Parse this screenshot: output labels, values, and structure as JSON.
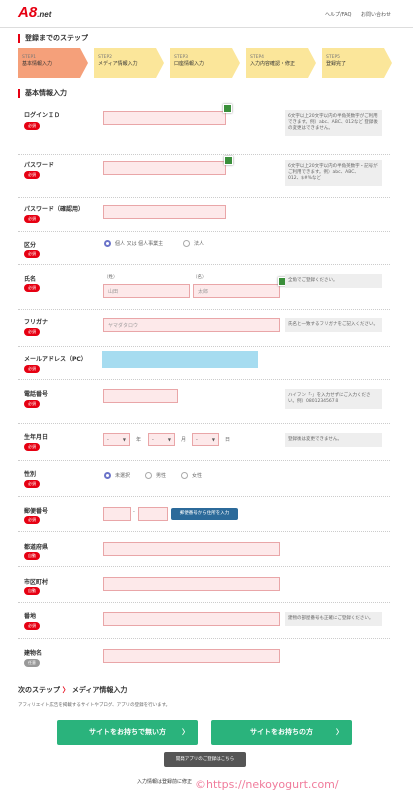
{
  "header": {
    "logo": "A8",
    "logo_sub": ".net",
    "links": [
      "ヘルプ/FAQ",
      "お問い合わせ"
    ]
  },
  "steps_title": "登録までのステップ",
  "steps": [
    {
      "num": "STEP1",
      "label": "基本情報入力"
    },
    {
      "num": "STEP2",
      "label": "メディア情報入力"
    },
    {
      "num": "STEP3",
      "label": "口座情報入力"
    },
    {
      "num": "STEP4",
      "label": "入力内容確認・修正"
    },
    {
      "num": "STEP5",
      "label": "登録完了"
    }
  ],
  "basic_title": "基本情報入力",
  "badges": {
    "required": "必須",
    "auto": "自動",
    "any": "任意"
  },
  "fields": {
    "login_id": {
      "label": "ログインＩＤ",
      "note": "6文字以上20文字以内の半角英数字がご利用できます。例）abc、ABC、012など 登録後の変更はできません。"
    },
    "password": {
      "label": "パスワード",
      "note": "6文字以上20文字以内の半角英数字・記号がご利用できます。例）abc、ABC、012、$#%など"
    },
    "password_confirm": {
      "label": "パスワード（確認用）"
    },
    "kubun": {
      "label": "区分",
      "opt1": "個人 又は 個人事業主",
      "opt2": "法人"
    },
    "name": {
      "label": "氏名",
      "sei": "（姓）",
      "mei": "（名）",
      "sei_ph": "山田",
      "mei_ph": "太郎",
      "note": "全角でご登録ください。"
    },
    "furigana": {
      "label": "フリガナ",
      "ph": "ヤマダタロウ",
      "note": "氏名と一致するフリガナをご記入ください。"
    },
    "email": {
      "label": "メールアドレス（PC）"
    },
    "phone": {
      "label": "電話番号",
      "note": "ハイフン「-」を入力せずにご入力ください。例）0801234567８"
    },
    "birth": {
      "label": "生年月日",
      "year": "-",
      "month": "-",
      "day": "-",
      "u_year": "年",
      "u_month": "月",
      "u_day": "日",
      "note": "登録後は変更できません。"
    },
    "gender": {
      "label": "性別",
      "opt1": "未選択",
      "opt2": "男性",
      "opt3": "女性"
    },
    "zip": {
      "label": "郵便番号",
      "dash": "-",
      "btn": "郵便番号から住所を入力"
    },
    "pref": {
      "label": "都道府県"
    },
    "city": {
      "label": "市区町村"
    },
    "address": {
      "label": "番地",
      "note": "建物の部屋番号も正確にご登録ください。"
    },
    "building": {
      "label": "建物名"
    }
  },
  "next": {
    "title_a": "次のステップ",
    "arrow": "〉",
    "title_b": "メディア情報入力",
    "desc": "アフィリエイト広告を掲載するサイトやブログ、アプリの登録を行います。"
  },
  "buttons": {
    "no_site": "サイトをお持ちで無い方",
    "has_site": "サイトをお持ちの方",
    "chev": "〉",
    "dev": "開発アプリのご登録はこちら"
  },
  "footer_note": "入力情報は登録前に修正",
  "watermark": "©https://nekoyogurt.com/",
  "colors": {
    "accent": "#e60012",
    "step": "#fbe69a",
    "step_active": "#f5a07a",
    "green": "#2ab37c",
    "email_fill": "#a6dcf0"
  }
}
